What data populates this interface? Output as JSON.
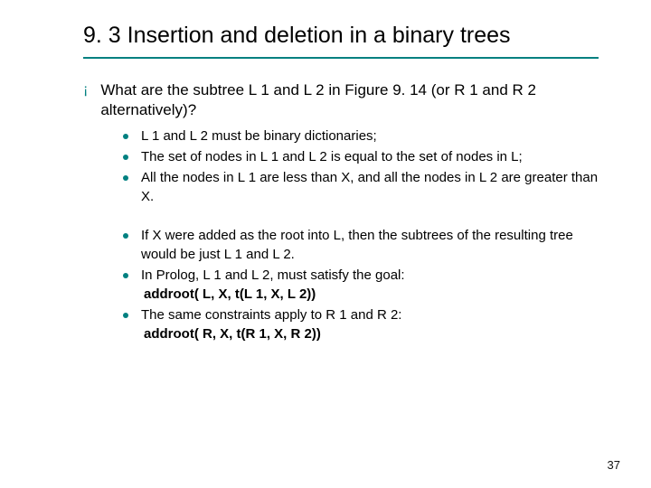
{
  "title": "9. 3 Insertion and deletion in a binary trees",
  "question": "What are the subtree L 1 and L 2 in Figure 9. 14 (or R 1 and R 2 alternatively)?",
  "group1": [
    "L 1 and L 2 must be binary dictionaries;",
    "The set of nodes in L 1 and L 2 is equal to the set of nodes in L;",
    "All the nodes in L 1 are less than X, and all the nodes in L 2 are greater than X."
  ],
  "group2": [
    {
      "text": "If X were added as the root into L, then the subtrees of the resulting tree would be just L 1 and L 2."
    },
    {
      "text": "In Prolog, L 1 and L 2, must satisfy the goal:",
      "code": "addroot( L, X, t(L 1, X, L 2))"
    },
    {
      "text": "The same constraints apply to R 1 and R 2:",
      "code": "addroot( R, X, t(R 1, X, R 2))"
    }
  ],
  "page_number": "37",
  "bullet_lvl1": "¡"
}
